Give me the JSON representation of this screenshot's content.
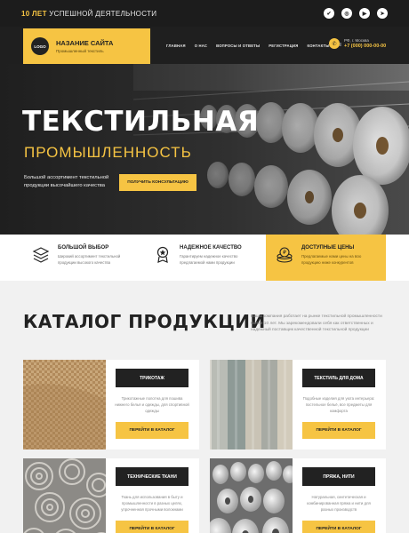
{
  "topbar": {
    "years_highlight": "10 ЛЕТ",
    "years_text": " УСПЕШНОЙ ДЕЯТЕЛЬНОСТИ",
    "socials": [
      "vk-icon",
      "instagram-icon",
      "youtube-icon",
      "telegram-icon"
    ],
    "social_glyphs": [
      "✔",
      "◎",
      "▶",
      "➤"
    ]
  },
  "header": {
    "logo_text": "LOGO",
    "site_title": "НАЗАНИЕ САЙТА",
    "site_subtitle": "Промышленный текстиль",
    "nav": [
      "ГЛАВНАЯ",
      "О НАС",
      "ВОПРОСЫ И ОТВЕТЫ",
      "РЕГИСТРАЦИЯ",
      "КОНТАКТЫ"
    ],
    "menu_glyph": "≡",
    "city": "РФ, г. Москва",
    "phone": "+7 (000) 000-00-00"
  },
  "hero": {
    "title": "ТЕКСТИЛЬНАЯ",
    "subtitle": "ПРОМЫШЛЕННОСТЬ",
    "description": "Большой ассортимент текстильной продукции высочайшего качества",
    "button": "ПОЛУЧИТЬ КОНСУЛЬТАЦИЮ"
  },
  "features": [
    {
      "icon": "fabric-stack-icon",
      "title": "БОЛЬШОЙ ВЫБОР",
      "desc": "Широкий ассортимент текстильной продукции высокого качества"
    },
    {
      "icon": "award-icon",
      "title": "НАДЕЖНОЕ КАЧЕСТВО",
      "desc": "Гарантируем надежное качество предлагаемой нами продукции"
    },
    {
      "icon": "coins-icon",
      "title": "ДОСТУПНЫЕ ЦЕНЫ",
      "desc": "Предлагаемые нами цены на всю продукцию ниже конкурентов"
    }
  ],
  "catalog": {
    "title": "КАТАЛОГ ПРОДУКЦИИ",
    "description": "Наша компания работает на рынке текстильной промышленности более 10 лет. Мы зарекомендовали себя как ответственных и надежный поставщик качественной текстильной продукции",
    "items": [
      {
        "label": "ТРИКОТАЖ",
        "desc": "Трикотажные полотна для пошива нижнего белья и одежды, для спортивной одежды",
        "button": "ПЕРЕЙТИ В КАТАЛОГ"
      },
      {
        "label": "ТЕКСТИЛЬ ДЛЯ ДОМА",
        "desc": "Подобные изделия для уюта интерьера: постельное бельё, все предметы для комфорта",
        "button": "ПЕРЕЙТИ В КАТАЛОГ"
      },
      {
        "label": "ТЕХНИЧЕСКИЕ ТКАНИ",
        "desc": "Ткань для использования в быту и промышленности в разных целях, упрочненная прочными волокнами",
        "button": "ПЕРЕЙТИ В КАТАЛОГ"
      },
      {
        "label": "ПРЯЖА, НИТИ",
        "desc": "Натуральная, синтетическая и комбинированная пряжа и нити для разных производств",
        "button": "ПЕРЕЙТИ В КАТАЛОГ"
      }
    ]
  },
  "colors": {
    "accent": "#f6c443",
    "dark": "#1f1f1f",
    "card_label": "#222222"
  }
}
